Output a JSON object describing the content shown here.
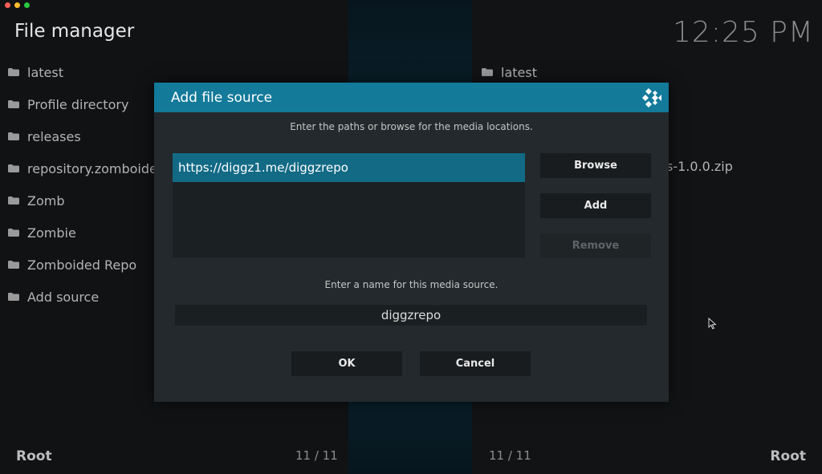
{
  "window": {
    "colors": {
      "close": "#ff5f57",
      "minimize": "#febc2e",
      "maximize": "#28c840"
    }
  },
  "header": {
    "title": "File manager",
    "clock": "12:25 PM"
  },
  "left_pane": {
    "items": [
      "latest",
      "Profile directory",
      "releases",
      "repository.zomboided",
      "Zomb",
      "Zombie",
      "Zomboided Repo",
      "Add source"
    ],
    "footer_label": "Root",
    "count": "11 / 11"
  },
  "right_pane": {
    "items": [
      "latest"
    ],
    "partial_item": "s-1.0.0.zip",
    "footer_label": "Root",
    "count": "11 / 11"
  },
  "dialog": {
    "title": "Add file source",
    "instruction_paths": "Enter the paths or browse for the media locations.",
    "paths": [
      "https://diggz1.me/diggzrepo"
    ],
    "browse_label": "Browse",
    "add_label": "Add",
    "remove_label": "Remove",
    "instruction_name": "Enter a name for this media source.",
    "name_value": "diggzrepo",
    "ok_label": "OK",
    "cancel_label": "Cancel",
    "accent": "#137a9a"
  },
  "icons": {
    "folder": "folder-icon",
    "logo": "kodi-logo-icon",
    "cursor": "mouse-pointer-icon"
  }
}
